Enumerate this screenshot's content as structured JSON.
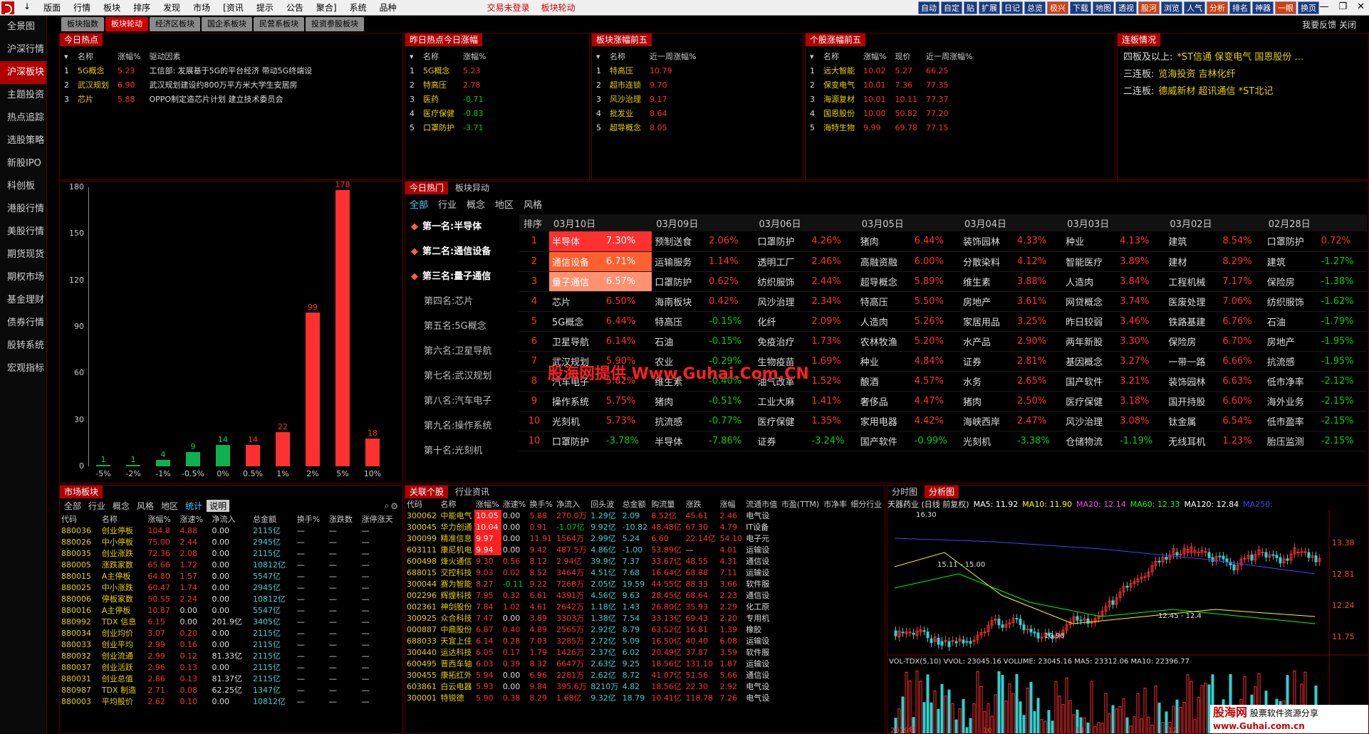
{
  "menu": [
    "↓",
    "版面",
    "行情",
    "板块",
    "排序",
    "发现",
    "市场",
    "[资讯",
    "提示",
    "公告",
    "聚合]",
    "系统",
    "品种"
  ],
  "menu_center": [
    "交易未登录",
    "板块轮动"
  ],
  "toolbar": [
    "自动",
    "自定",
    "贴",
    "扩展",
    "日记",
    "总览",
    "极兴",
    "下载",
    "地图",
    "透视",
    "股河",
    "浏览",
    "人气",
    "分析",
    "排名",
    "神器",
    "一眼",
    "换页"
  ],
  "sidebar": [
    "全景图",
    "沪深行情",
    "沪深板块",
    "主题投资",
    "热点追踪",
    "选股策略",
    "新股IPO",
    "科创板",
    "港股行情",
    "美股行情",
    "期货现货",
    "期权市场",
    "基金理财",
    "债券行情",
    "股转系统",
    "宏观指标"
  ],
  "tabs": [
    "板块指数",
    "板块轮动",
    "经济区板块",
    "国企系板块",
    "民营系板块",
    "投资参股板块"
  ],
  "topright": "我要反馈  关闭",
  "today_hot": {
    "title": "今日热点",
    "headers": [
      "名称",
      "涨幅%",
      "驱动因素"
    ],
    "rows": [
      [
        "1",
        "5G概念",
        "5.23",
        "工信部: 发展基于5G的平台经济 带动5G终端设"
      ],
      [
        "2",
        "武汉规划",
        "6.90",
        "武汉规划建设约800万平方米大学生安居房"
      ],
      [
        "3",
        "芯片",
        "5.88",
        "OPPO制定造芯片计划 建立技术委员会"
      ]
    ]
  },
  "yest_hot": {
    "title": "昨日热点今日涨幅",
    "headers": [
      "名称",
      "涨幅%"
    ],
    "rows": [
      [
        "1",
        "5G概念",
        "5.23"
      ],
      [
        "2",
        "特高压",
        "2.78"
      ],
      [
        "3",
        "医药",
        "-0.71"
      ],
      [
        "4",
        "医疗保健",
        "-0.83"
      ],
      [
        "5",
        "口罩防护",
        "-3.71"
      ]
    ]
  },
  "block_top5": {
    "title": "板块涨幅前五",
    "headers": [
      "名称",
      "近一周涨幅%"
    ],
    "rows": [
      [
        "1",
        "特高压",
        "10.79"
      ],
      [
        "2",
        "超市连锁",
        "9.70"
      ],
      [
        "3",
        "风沙治理",
        "9.17"
      ],
      [
        "4",
        "批发业",
        "8.64"
      ],
      [
        "5",
        "超导概念",
        "8.05"
      ]
    ]
  },
  "stock_top5": {
    "title": "个股涨幅前五",
    "headers": [
      "名称",
      "涨幅%",
      "现价",
      "近一周涨幅%"
    ],
    "rows": [
      [
        "1",
        "远大智能",
        "10.02",
        "5.27",
        "66.25"
      ],
      [
        "2",
        "保变电气",
        "10.01",
        "7.36",
        "77.35"
      ],
      [
        "3",
        "海源复材",
        "10.01",
        "10.11",
        "77.37"
      ],
      [
        "4",
        "国恩股份",
        "10.00",
        "50.82",
        "77.20"
      ],
      [
        "5",
        "海特生物",
        "9.99",
        "69.78",
        "77.15"
      ]
    ]
  },
  "lianban": {
    "title": "连板情况",
    "rows": [
      [
        "四板及以上:",
        "*ST信通  保变电气  国恩股份  …"
      ],
      [
        "三连板:",
        "览海投资  吉林化纤"
      ],
      [
        "二连板:",
        "德威新材  超讯通信  *ST北记"
      ]
    ]
  },
  "chart_data": {
    "type": "bar",
    "categories": [
      "-5%",
      "-2%",
      "-1%",
      "-0.5%",
      "0%",
      "0.5%",
      "1%",
      "2%",
      "5%",
      "10%"
    ],
    "values": [
      1,
      1,
      4,
      9,
      14,
      14,
      22,
      99,
      178,
      18
    ],
    "colors": [
      "green",
      "green",
      "green",
      "green",
      "green",
      "red",
      "red",
      "red",
      "red",
      "red"
    ],
    "ylim": [
      0,
      180
    ],
    "yticks": [
      0,
      30,
      60,
      90,
      120,
      150,
      180
    ]
  },
  "rotation": {
    "tabs": [
      "今日热门",
      "板块异动"
    ],
    "filters": [
      "全部",
      "行业",
      "概念",
      "地区",
      "风格"
    ],
    "ranks": [
      "第一名:半导体",
      "第二名:通信设备",
      "第三名:量子通信",
      "第四名:芯片",
      "第五名:5G概念",
      "第六名:卫星导航",
      "第七名:武汉规划",
      "第八名:汽车电子",
      "第九名:操作系统",
      "第十名:光刻机"
    ],
    "dates": [
      "排序",
      "03月10日",
      "03月09日",
      "03月06日",
      "03月05日",
      "03月04日",
      "03月03日",
      "03月02日",
      "02月28日"
    ],
    "rows": [
      [
        "1",
        "半导体",
        "7.30%",
        "预制送食",
        "2.06%",
        "口罩防护",
        "4.26%",
        "猪肉",
        "6.44%",
        "装饰园林",
        "4.33%",
        "种业",
        "4.13%",
        "建筑",
        "8.54%",
        "口罩防护",
        "0.72%"
      ],
      [
        "2",
        "通信设备",
        "6.71%",
        "运输服务",
        "1.14%",
        "透明工厂",
        "2.46%",
        "高融资融",
        "6.00%",
        "分散染料",
        "4.12%",
        "智能医疗",
        "3.89%",
        "建材",
        "8.29%",
        "建筑",
        "-1.27%"
      ],
      [
        "3",
        "量子通信",
        "6.57%",
        "口罩防护",
        "0.62%",
        "纺织服饰",
        "2.44%",
        "超导概念",
        "5.89%",
        "维生素",
        "3.88%",
        "人造肉",
        "3.84%",
        "工程机械",
        "7.17%",
        "保险房",
        "-1.38%"
      ],
      [
        "4",
        "芯片",
        "6.50%",
        "海南板块",
        "0.42%",
        "风沙治理",
        "2.34%",
        "特高压",
        "5.50%",
        "房地产",
        "3.61%",
        "网贷概念",
        "3.74%",
        "医废处理",
        "7.06%",
        "纺织服饰",
        "-1.62%"
      ],
      [
        "5",
        "5G概念",
        "6.44%",
        "特高压",
        "-0.15%",
        "化纤",
        "2.09%",
        "人造肉",
        "5.26%",
        "家居用品",
        "3.25%",
        "昨日较弱",
        "3.46%",
        "铁路基建",
        "6.76%",
        "石油",
        "-1.79%"
      ],
      [
        "6",
        "卫星导航",
        "6.14%",
        "石油",
        "-0.15%",
        "免疫治疗",
        "1.73%",
        "农林牧渔",
        "5.20%",
        "水产品",
        "2.90%",
        "两年新股",
        "3.30%",
        "保险房",
        "6.70%",
        "房地产",
        "-1.95%"
      ],
      [
        "7",
        "武汉规划",
        "5.90%",
        "农业",
        "-0.29%",
        "生物疫苗",
        "1.69%",
        "种业",
        "4.84%",
        "证券",
        "2.81%",
        "基因概念",
        "3.27%",
        "一带一路",
        "6.66%",
        "抗流感",
        "-1.95%"
      ],
      [
        "8",
        "汽车电子",
        "5.82%",
        "维生素",
        "-0.40%",
        "油气改革",
        "1.52%",
        "酿酒",
        "4.57%",
        "水务",
        "2.65%",
        "国产软件",
        "3.21%",
        "装饰园林",
        "6.63%",
        "低市净率",
        "-2.12%"
      ],
      [
        "9",
        "操作系统",
        "5.75%",
        "猪肉",
        "-0.51%",
        "工业大麻",
        "1.41%",
        "奢侈品",
        "4.47%",
        "猪肉",
        "2.50%",
        "医疗保健",
        "3.18%",
        "国开持股",
        "6.60%",
        "海外业务",
        "-2.15%"
      ],
      [
        "10",
        "光刻机",
        "5.73%",
        "抗流感",
        "-0.77%",
        "医疗保健",
        "1.35%",
        "家用电器",
        "4.42%",
        "海峡西岸",
        "2.47%",
        "风沙治理",
        "3.08%",
        "钛金属",
        "6.54%",
        "低市盈率",
        "-2.15%"
      ],
      [
        "10",
        "口罩防护",
        "-3.78%",
        "半导体",
        "-7.86%",
        "证券",
        "-3.24%",
        "国产软件",
        "-0.99%",
        "光刻机",
        "-3.38%",
        "仓储物流",
        "-1.19%",
        "无线耳机",
        "1.23%",
        "胎压监测",
        "-2.15%"
      ]
    ]
  },
  "watermark": "股海网提供 Www.Guhai.Com.CN",
  "market": {
    "title": "市场板块",
    "filters": [
      "全部",
      "行业",
      "概念",
      "风格",
      "地区",
      "统计",
      "说明"
    ],
    "headers": [
      "代码",
      "名称",
      "涨幅%",
      "涨速%",
      "净流入",
      "总金额",
      "换手%",
      "涨跌数",
      "涨停涨天"
    ],
    "rows": [
      [
        "880036",
        "创业停板",
        "104.8",
        "4.88",
        "0.00",
        "2115亿"
      ],
      [
        "880026",
        "中小停板",
        "75.00",
        "2.44",
        "0.00",
        "2945亿"
      ],
      [
        "880035",
        "创业涨跌",
        "72.36",
        "2.08",
        "0.00",
        "2115亿"
      ],
      [
        "880005",
        "涨跌家数",
        "65.66",
        "1.72",
        "0.00",
        "10812亿"
      ],
      [
        "880015",
        "A主停板",
        "64.80",
        "1.57",
        "0.00",
        "5547亿"
      ],
      [
        "880025",
        "中小涨跌",
        "60.47",
        "1.74",
        "0.00",
        "2945亿"
      ],
      [
        "880006",
        "停板家数",
        "50.55",
        "2.24",
        "0.00",
        "10812亿"
      ],
      [
        "880016",
        "A主停板",
        "10.87",
        "0.00",
        "0.00",
        "5547亿"
      ],
      [
        "880992",
        "TDX 信息",
        "6.15",
        "0.00",
        "201.9亿",
        "3405亿"
      ],
      [
        "880034",
        "创业均价",
        "3.07",
        "0.20",
        "0.00",
        "2115亿"
      ],
      [
        "880033",
        "创业平均",
        "2.99",
        "0.16",
        "0.00",
        "2115亿"
      ],
      [
        "880032",
        "创业流通",
        "2.99",
        "0.12",
        "81.33亿",
        "2115亿"
      ],
      [
        "880037",
        "创业活跃",
        "2.96",
        "0.13",
        "0.00",
        "2115亿"
      ],
      [
        "880031",
        "创业总值",
        "2.86",
        "0.13",
        "81.37亿",
        "2115亿"
      ],
      [
        "880987",
        "TDX 制造",
        "2.71",
        "0.08",
        "62.25亿",
        "1347亿"
      ],
      [
        "880003",
        "平均股价",
        "2.62",
        "0.10",
        "0.00",
        "10812亿"
      ]
    ]
  },
  "stocks": {
    "tabs": [
      "关联个股",
      "行业资讯"
    ],
    "headers": [
      "代码",
      "名称",
      "涨幅%",
      "涨速%",
      "换手%",
      "净流入",
      "回头波",
      "总金额",
      "购流量",
      "涨跌",
      "涨幅",
      "流通市值",
      "市盈(TTM)",
      "市净率",
      "细分行业"
    ],
    "rows": [
      [
        "300062",
        "中能电气",
        "10.05",
        "0.00",
        "5.88",
        "270.0万",
        "1.29亿",
        "2.09",
        "8.52亿",
        "45.61",
        "2.46",
        "电气设"
      ],
      [
        "300045",
        "华力创通",
        "10.04",
        "0.00",
        "0.91",
        "-1.07亿",
        "9.92亿",
        "-10.82",
        "48.48亿",
        "67.30",
        "4.79",
        "IT设备"
      ],
      [
        "300099",
        "精准信息",
        "9.97",
        "0.00",
        "11.91",
        "1564万",
        "2.99亿",
        "5.24",
        "6.60",
        "22.14亿",
        "54.10",
        "电子元"
      ],
      [
        "603111",
        "康尼机电",
        "9.94",
        "0.00",
        "9.42",
        "487.5万",
        "4.86亿",
        "-1.00",
        "53.89亿",
        "—",
        "4.01",
        "运输设"
      ],
      [
        "600498",
        "烽火通信",
        "9.30",
        "0.56",
        "8.12",
        "2.94亿",
        "39.9亿",
        "7.37",
        "33.67亿",
        "48.55",
        "4.31",
        "通信设"
      ],
      [
        "688015",
        "交控科技",
        "9.03",
        "0.02",
        "8.52",
        "3464万",
        "4.51亿",
        "7.68",
        "16.64亿",
        "68.88",
        "7.11",
        "运输设"
      ],
      [
        "300044",
        "赛为智能",
        "8.27",
        "-0.11",
        "9.22",
        "7268万",
        "2.05亿",
        "19.59",
        "44.55亿",
        "88.33",
        "3.66",
        "软件服"
      ],
      [
        "002296",
        "辉煌科技",
        "7.95",
        "0.32",
        "6.61",
        "4391万",
        "4.56亿",
        "9.63",
        "28.45亿",
        "68.64",
        "2.23",
        "通信设"
      ],
      [
        "002361",
        "神剑股份",
        "7.84",
        "1.02",
        "4.61",
        "2642万",
        "1.18亿",
        "1.43",
        "26.80亿",
        "35.93",
        "2.29",
        "化工原"
      ],
      [
        "300925",
        "众合科技",
        "7.47",
        "0.00",
        "3.89",
        "3303万",
        "1.38亿",
        "7.54",
        "33.13亿",
        "69.43",
        "2.20",
        "专用机"
      ],
      [
        "000887",
        "中鼎股份",
        "6.87",
        "0.40",
        "4.89",
        "2565万",
        "2.92亿",
        "8.79",
        "63.52亿",
        "16.81",
        "1.39",
        "橡胶"
      ],
      [
        "688033",
        "天宜上佳",
        "6.14",
        "0.28",
        "7.03",
        "3285万",
        "2.72亿",
        "5.09",
        "16.50亿",
        "40.40",
        "6.08",
        "运输设"
      ],
      [
        "300440",
        "运达科技",
        "6.05",
        "0.17",
        "1.79",
        "1426万",
        "2.37亿",
        "6.02",
        "20.49亿",
        "37.87",
        "3.59",
        "软件服"
      ],
      [
        "600495",
        "晋西车轴",
        "6.03",
        "0.39",
        "8.32",
        "6647万",
        "2.63亿",
        "9.25",
        "18.56亿",
        "131.10",
        "1.87",
        "运输设"
      ],
      [
        "300455",
        "康拓红外",
        "5.94",
        "0.00",
        "6.96",
        "2281万",
        "2.62亿",
        "8.72",
        "41.07亿",
        "51.56",
        "5.66",
        "通信设"
      ],
      [
        "603861",
        "白云电器",
        "5.93",
        "0.00",
        "9.84",
        "395.6万",
        "8210万",
        "4.82",
        "18.56亿",
        "22.30",
        "2.92",
        "电气设"
      ],
      [
        "300001",
        "特锐德",
        "5.90",
        "0.38",
        "8.29",
        "1.68亿",
        "9.32亿",
        "18.79",
        "10.41亿",
        "118.78",
        "7.26",
        "电气设"
      ]
    ]
  },
  "kline": {
    "tabs": [
      "分时图",
      "分析图"
    ],
    "header": "天器药业 (日线 前复权)",
    "ma": [
      [
        "MA5: 11.92",
        "#ffffff"
      ],
      [
        "MA10: 11.90",
        "#ffff00"
      ],
      [
        "MA20: 12.14",
        "#ff40ff"
      ],
      [
        "MA60: 12.33",
        "#00ff00"
      ],
      [
        "MA120: 12.84",
        "#ffffff"
      ],
      [
        "MA250:",
        "#4040ff"
      ]
    ],
    "yticks": [
      "13.38",
      "12.81",
      "12.24",
      "11.75"
    ],
    "annotations": [
      "16.30",
      "15.11 - 15.00",
      "12.45 - 12.4",
      "10.98"
    ],
    "vol_header": "VOL-TDX(5,10) VVOL: 23045.16  VOLUME: 23045.16  MA5: 23312.06  MA10: 22396.77",
    "xlabels": [
      "2019年",
      "10",
      "11",
      "12",
      "2020年"
    ]
  },
  "brand": {
    "name": "股海网",
    "slogan": "股票软件资源分享",
    "url": "www.Guhai.com.cn"
  }
}
